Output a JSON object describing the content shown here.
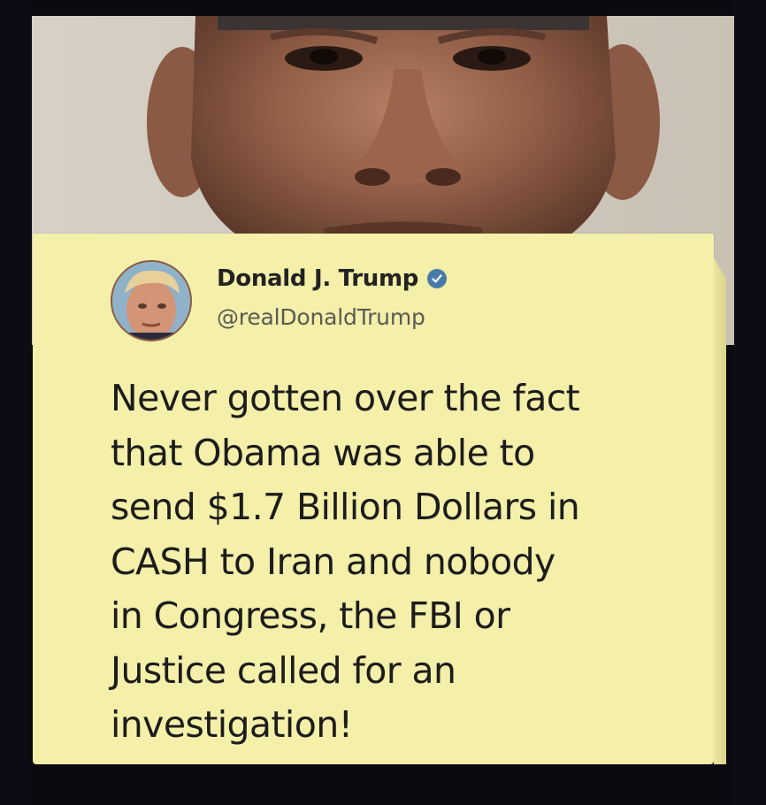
{
  "tweet": {
    "author_name": "Donald J. Trump",
    "author_handle": "@realDonaldTrump",
    "verified_icon": "verified-badge-icon",
    "avatar_icon": "profile-photo",
    "lines": [
      "Never gotten over the fact",
      "that Obama was able to",
      "send $1.7 Billion Dollars in",
      "CASH to Iran and nobody",
      "in Congress, the FBI or",
      "Justice called for an",
      "investigation!"
    ]
  },
  "colors": {
    "card_background": "#f4efa9",
    "verified_badge": "#4a7aa8",
    "page_background": "#0c0c14"
  }
}
